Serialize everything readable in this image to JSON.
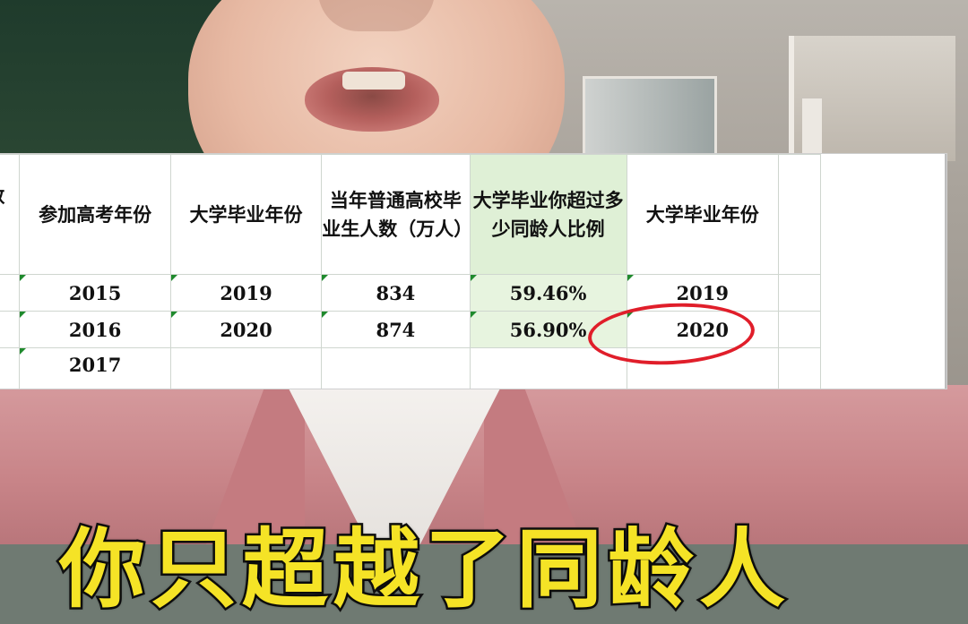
{
  "table": {
    "headers": [
      "人数",
      "参加高考年份",
      "大学毕业年份",
      "当年普通高校毕业生人数（万人）",
      "大学毕业你超过多少同龄人比例",
      "大学毕业年份"
    ],
    "rows": [
      [
        "",
        "2015",
        "2019",
        "834",
        "59.46%",
        "2019"
      ],
      [
        "",
        "2016",
        "2020",
        "874",
        "56.90%",
        "2020"
      ],
      [
        "",
        "2017",
        "",
        "",
        "",
        ""
      ]
    ],
    "highlight_color": "#dff0d6",
    "circled_value": "56.90%",
    "circle_color": "#e01e2a"
  },
  "subtitle": {
    "text": "你只超越了同龄人",
    "color": "#f5e326"
  }
}
